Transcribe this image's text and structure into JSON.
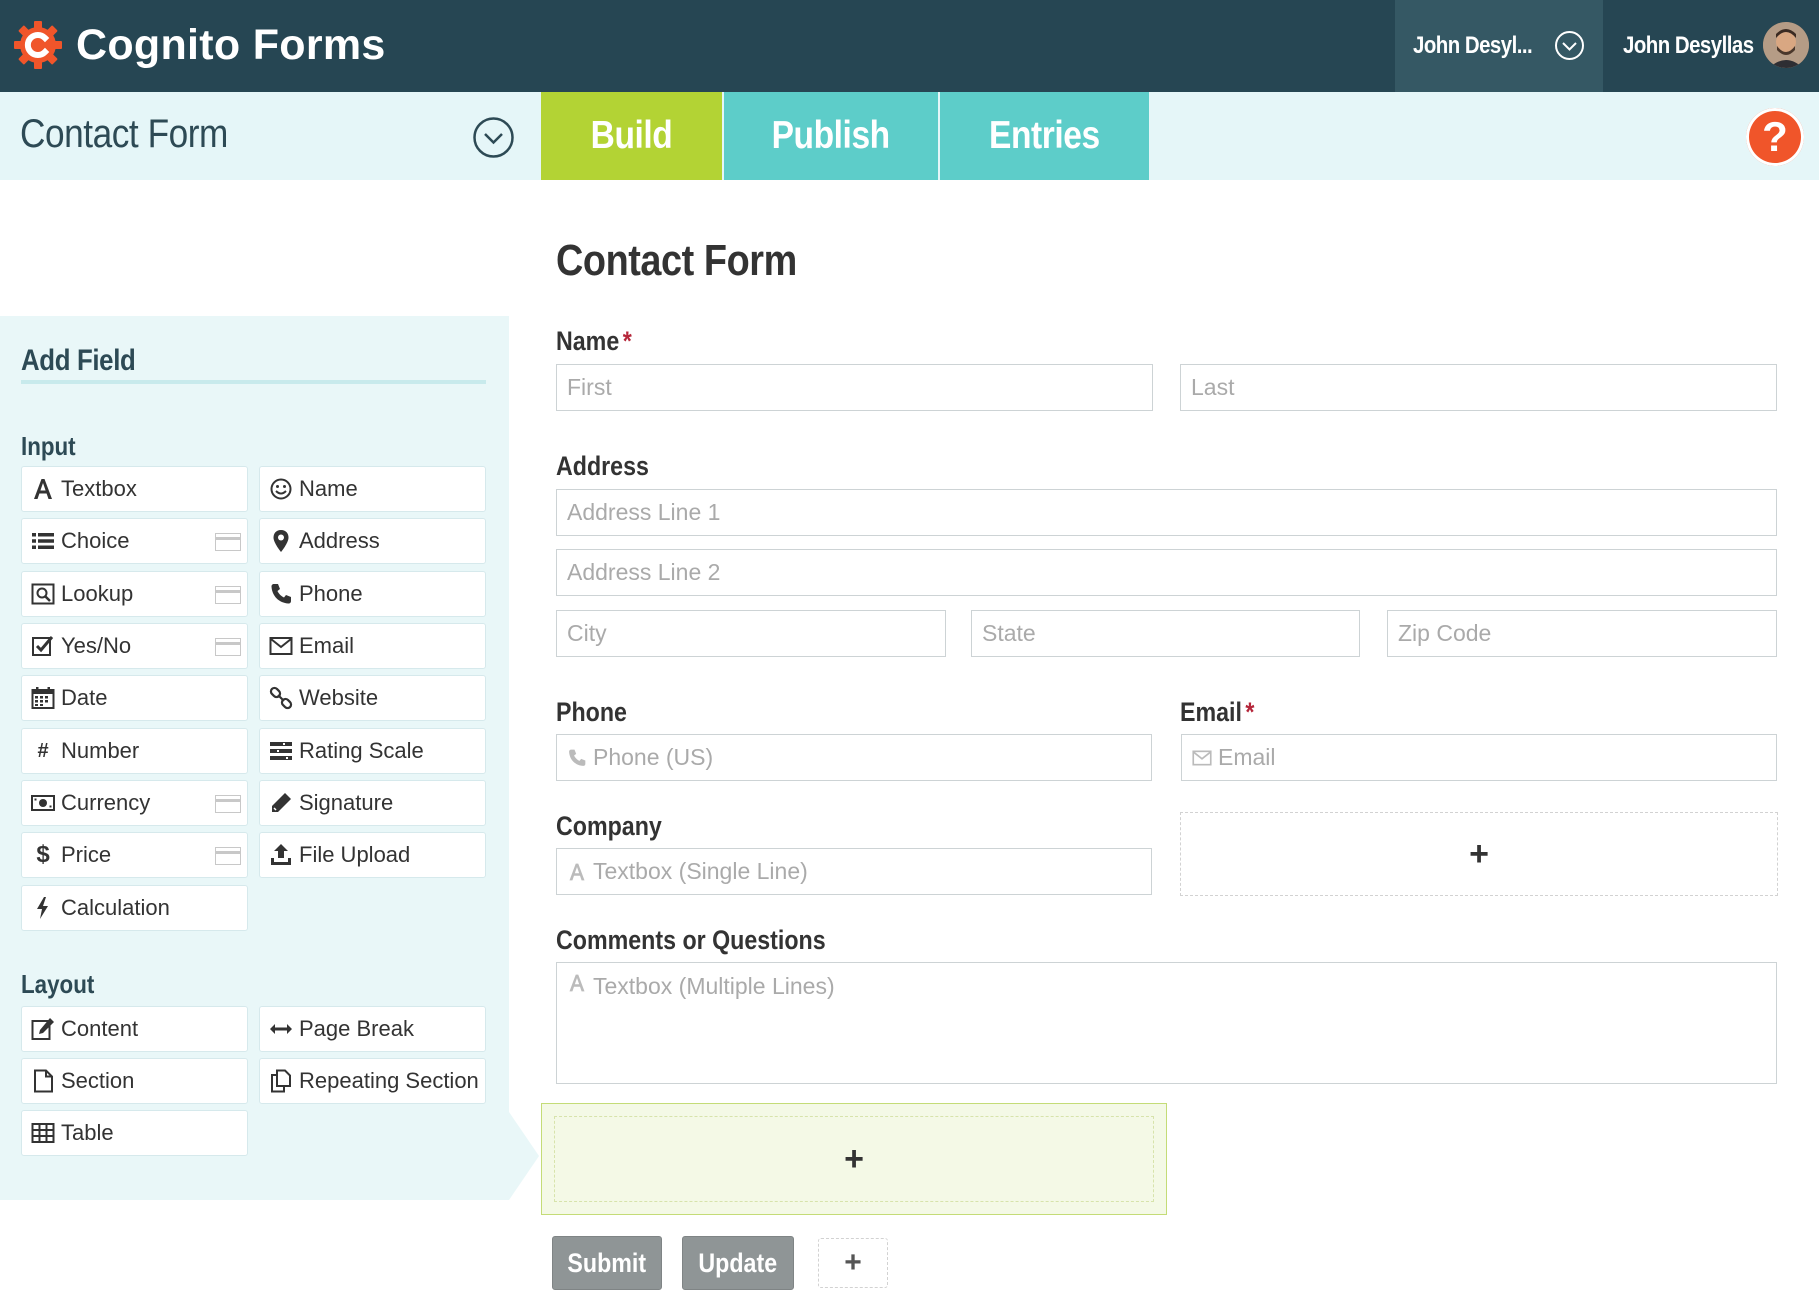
{
  "app": {
    "name": "Cognito Forms"
  },
  "header": {
    "org_name": "John Desyl...",
    "user_name": "John Desyllas"
  },
  "subbar": {
    "form_title": "Contact Form",
    "tabs": [
      {
        "label": "Build"
      },
      {
        "label": "Publish"
      },
      {
        "label": "Entries"
      }
    ],
    "help_label": "?"
  },
  "add_field": {
    "title": "Add Field",
    "input_label": "Input",
    "input_items": [
      {
        "label": "Textbox",
        "icon": "textbox-icon"
      },
      {
        "label": "Name",
        "icon": "smiley-icon"
      },
      {
        "label": "Choice",
        "icon": "list-icon"
      },
      {
        "label": "Address",
        "icon": "map-pin-icon"
      },
      {
        "label": "Lookup",
        "icon": "lookup-icon"
      },
      {
        "label": "Phone",
        "icon": "phone-icon"
      },
      {
        "label": "Yes/No",
        "icon": "checkbox-icon"
      },
      {
        "label": "Email",
        "icon": "envelope-icon"
      },
      {
        "label": "Date",
        "icon": "calendar-icon"
      },
      {
        "label": "Website",
        "icon": "link-icon"
      },
      {
        "label": "Number",
        "icon": "hash-icon"
      },
      {
        "label": "Rating Scale",
        "icon": "rating-scale-icon"
      },
      {
        "label": "Currency",
        "icon": "money-icon"
      },
      {
        "label": "Signature",
        "icon": "pencil-icon"
      },
      {
        "label": "Price",
        "icon": "dollar-icon"
      },
      {
        "label": "File Upload",
        "icon": "upload-icon"
      },
      {
        "label": "Calculation",
        "icon": "bolt-icon"
      }
    ],
    "layout_label": "Layout",
    "layout_items": [
      {
        "label": "Content",
        "icon": "edit-icon"
      },
      {
        "label": "Page Break",
        "icon": "arrows-horizontal-icon"
      },
      {
        "label": "Section",
        "icon": "file-icon"
      },
      {
        "label": "Repeating Section",
        "icon": "copy-icon"
      },
      {
        "label": "Table",
        "icon": "table-icon"
      }
    ]
  },
  "form": {
    "title": "Contact Form",
    "name_label": "Name",
    "required_mark": "*",
    "first_placeholder": "First",
    "last_placeholder": "Last",
    "address_label": "Address",
    "address1_placeholder": "Address Line 1",
    "address2_placeholder": "Address Line 2",
    "city_placeholder": "City",
    "state_placeholder": "State",
    "zip_placeholder": "Zip Code",
    "phone_label": "Phone",
    "phone_placeholder": "Phone (US)",
    "email_label": "Email",
    "email_placeholder": "Email",
    "company_label": "Company",
    "company_placeholder": "Textbox (Single Line)",
    "comments_label": "Comments or Questions",
    "comments_placeholder": "Textbox (Multiple Lines)",
    "add_symbol": "+",
    "submit_label": "Submit",
    "update_label": "Update"
  },
  "colors": {
    "topbar": "#264653",
    "build_tab": "#b3d334",
    "other_tabs": "#5dcdc9",
    "help": "#f0552a",
    "required": "#b5263a"
  }
}
